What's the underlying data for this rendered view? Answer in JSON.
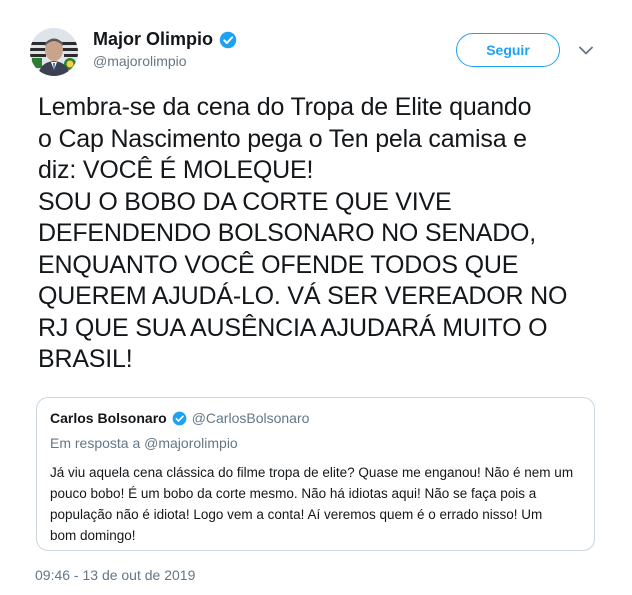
{
  "author": {
    "name": "Major Olimpio",
    "handle": "@majorolimpio",
    "verified": true,
    "avatar_icon": "profile-photo"
  },
  "follow_button": {
    "label": "Seguir"
  },
  "menu": {
    "icon": "chevron-down-icon"
  },
  "tweet": {
    "lines": [
      "Lembra-se da cena do Tropa de Elite quando",
      "o Cap Nascimento pega o Ten pela camisa e",
      "diz: VOCÊ É MOLEQUE!",
      "SOU O BOBO DA CORTE QUE VIVE",
      "DEFENDENDO BOLSONARO NO SENADO,",
      "ENQUANTO VOCÊ OFENDE TODOS QUE",
      "QUEREM AJUDÁ-LO. VÁ SER VEREADOR NO",
      "RJ QUE SUA AUSÊNCIA AJUDARÁ MUITO O",
      "BRASIL!"
    ]
  },
  "quoted_tweet": {
    "name": "Carlos Bolsonaro",
    "handle": "@CarlosBolsonaro",
    "verified": true,
    "reply_to": "Em resposta a @majorolimpio",
    "lines": [
      "Já viu aquela cena clássica do filme tropa de elite? Quase me enganou! Não é nem um",
      "pouco bobo! É um bobo da corte mesmo. Não há idiotas aqui! Não se faça pois a",
      "população não é idiota! Logo vem a conta! Aí veremos quem é o errado nisso! Um",
      "bom domingo!"
    ]
  },
  "timestamp": "09:46 - 13 de out de 2019",
  "colors": {
    "accent": "#1da1f2",
    "text": "#14171a",
    "secondary": "#657786",
    "border": "#ccd6dd"
  }
}
